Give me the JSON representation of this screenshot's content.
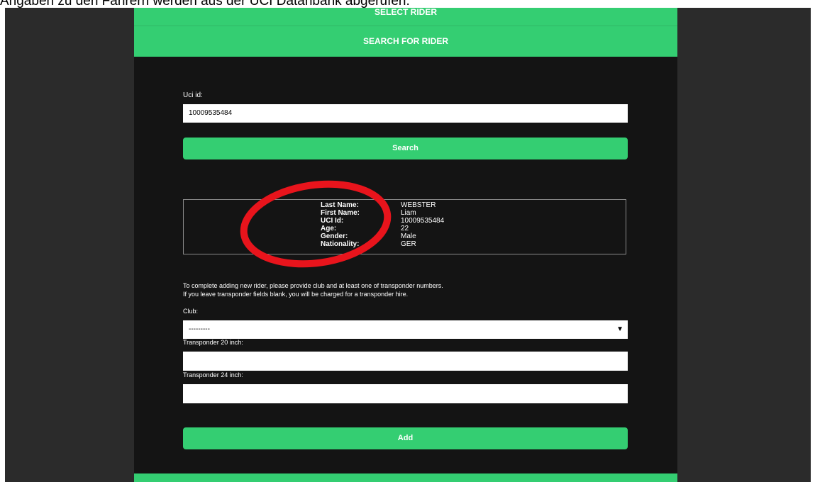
{
  "caption": "Angaben zu den Fahrern werden aus der UCI Datanbank abgerufen.",
  "header": {
    "select_rider": "SELECT RIDER",
    "search_for_rider": "SEARCH FOR RIDER"
  },
  "search": {
    "uci_label": "Uci id:",
    "uci_value": "10009535484",
    "search_button": "Search"
  },
  "rider": {
    "rows": [
      {
        "key": "Last Name:",
        "value": "WEBSTER"
      },
      {
        "key": "First Name:",
        "value": "Liam"
      },
      {
        "key": "UCI Id:",
        "value": "10009535484"
      },
      {
        "key": "Age:",
        "value": "22"
      },
      {
        "key": "Gender:",
        "value": "Male"
      },
      {
        "key": "Nationality:",
        "value": "GER"
      }
    ]
  },
  "form": {
    "note_line1": "To complete adding new rider, please provide club and at least one of transponder numbers.",
    "note_line2": "If you leave transponder fields blank, you will be charged for a transponder hire.",
    "club_label": "Club:",
    "club_value": "---------",
    "transponder20_label": "Transponder 20 inch:",
    "transponder20_value": "",
    "transponder24_label": "Transponder 24 inch:",
    "transponder24_value": "",
    "add_button": "Add"
  },
  "colors": {
    "accent": "#34ce72",
    "panel": "#141414",
    "backdrop": "#2b2b2b",
    "annotation": "#e8141c"
  }
}
